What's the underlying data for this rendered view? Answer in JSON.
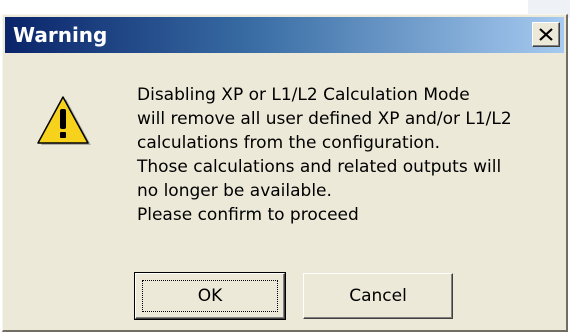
{
  "dialog": {
    "title": "Warning",
    "icon": "warning-triangle-icon",
    "message_lines": [
      "Disabling XP or L1/L2 Calculation Mode",
      "will remove all user defined XP and/or L1/L2",
      "calculations from the configuration.",
      "Those calculations and related outputs will",
      "no longer be available.",
      "Please confirm to proceed"
    ],
    "buttons": {
      "ok_label": "OK",
      "cancel_label": "Cancel"
    }
  },
  "colors": {
    "titlebar_start": "#0a246a",
    "titlebar_end": "#a6caf0",
    "dialog_bg": "#ece9d8",
    "warning_yellow": "#f7d21d"
  }
}
